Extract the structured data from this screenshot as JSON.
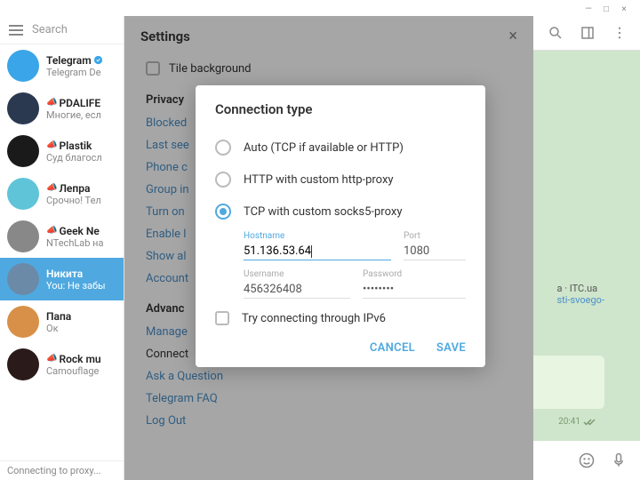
{
  "window": {
    "minimize": "—",
    "maximize": "□",
    "close": "×"
  },
  "leftPane": {
    "search": "Search",
    "chats": [
      {
        "title": "Telegram",
        "sub": "Telegram De",
        "verified": true,
        "avatarBg": "#3aa5e8",
        "avatarTxt": ""
      },
      {
        "title": "PDALIFE",
        "sub": "Многие, есл",
        "channel": true,
        "avatarBg": "#2a3850",
        "avatarTxt": ""
      },
      {
        "title": "Plastik",
        "sub": "Суд благосл",
        "channel": true,
        "avatarBg": "#1a1a1a",
        "avatarTxt": ""
      },
      {
        "title": "Лепра",
        "sub": "Срочно! Тел",
        "channel": true,
        "avatarBg": "#5fc4d8",
        "avatarTxt": ""
      },
      {
        "title": "Geek Ne",
        "sub": "NTechLab на",
        "channel": true,
        "avatarBg": "#888",
        "avatarTxt": ""
      },
      {
        "title": "Никита",
        "sub": "You: Не забы",
        "active": true,
        "avatarBg": "#6b8aa8",
        "avatarTxt": ""
      },
      {
        "title": "Папа",
        "sub": "Ок",
        "avatarBg": "#d89048",
        "avatarTxt": ""
      },
      {
        "title": "Rock mu",
        "sub": "Camouflage",
        "channel": true,
        "avatarBg": "#2a1a1a",
        "avatarTxt": ""
      }
    ],
    "status": "Connecting to proxy..."
  },
  "rightPane": {
    "link": {
      "domain": "a · ITC.ua",
      "path": "sti-svoego-"
    },
    "time": "20:41"
  },
  "settings": {
    "title": "Settings",
    "tileBg": "Tile background",
    "sectionPrivacy": "Privacy",
    "links1": [
      "Blocked",
      "Last see",
      "Phone c",
      "Group in",
      "Turn on",
      "Enable l",
      "Show al",
      "Account"
    ],
    "sectionAdvanced": "Advanc",
    "links2": [
      "Manage",
      "Connect",
      "Ask a Question",
      "Telegram FAQ",
      "Log Out"
    ]
  },
  "dialog": {
    "title": "Connection type",
    "opts": [
      "Auto (TCP if available or HTTP)",
      "HTTP with custom http-proxy",
      "TCP with custom socks5-proxy"
    ],
    "hostnameLabel": "Hostname",
    "hostname": "51.136.53.64",
    "portLabel": "Port",
    "port": "1080",
    "usernameLabel": "Username",
    "username": "456326408",
    "passwordLabel": "Password",
    "password": "••••••••",
    "ipv6": "Try connecting through IPv6",
    "cancel": "CANCEL",
    "save": "SAVE"
  }
}
